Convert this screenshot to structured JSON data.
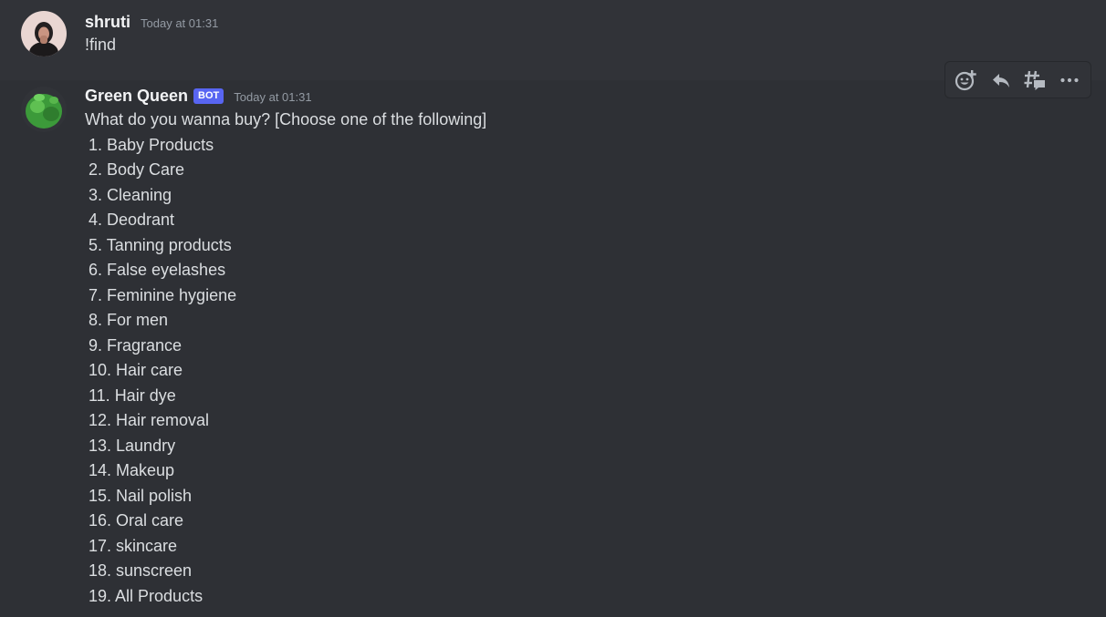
{
  "messages": [
    {
      "author": "shruti",
      "timestamp": "Today at 01:31",
      "text": "!find"
    },
    {
      "author": "Green Queen",
      "badge": "BOT",
      "timestamp": "Today at 01:31",
      "intro": "What do you wanna buy? [Choose one of the following]",
      "items": [
        "1. Baby Products",
        "2. Body Care",
        "3. Cleaning",
        "4. Deodrant",
        "5. Tanning products",
        "6. False eyelashes",
        "7. Feminine hygiene",
        "8. For men",
        "9. Fragrance",
        "10. Hair care",
        "11. Hair dye",
        "12. Hair removal",
        "13. Laundry",
        "14. Makeup",
        "15. Nail polish",
        "16. Oral care",
        "17. skincare",
        "18. sunscreen",
        "19. All Products"
      ]
    }
  ],
  "toolbar": {
    "icons": [
      "add-reaction-icon",
      "reply-icon",
      "create-thread-icon",
      "more-options-icon"
    ]
  },
  "colors": {
    "background": "#313338",
    "hover_background": "#2e3035",
    "bot_badge": "#5865f2",
    "username": "#f2f3f5",
    "timestamp": "#949ba4",
    "text": "#dbdee1"
  }
}
